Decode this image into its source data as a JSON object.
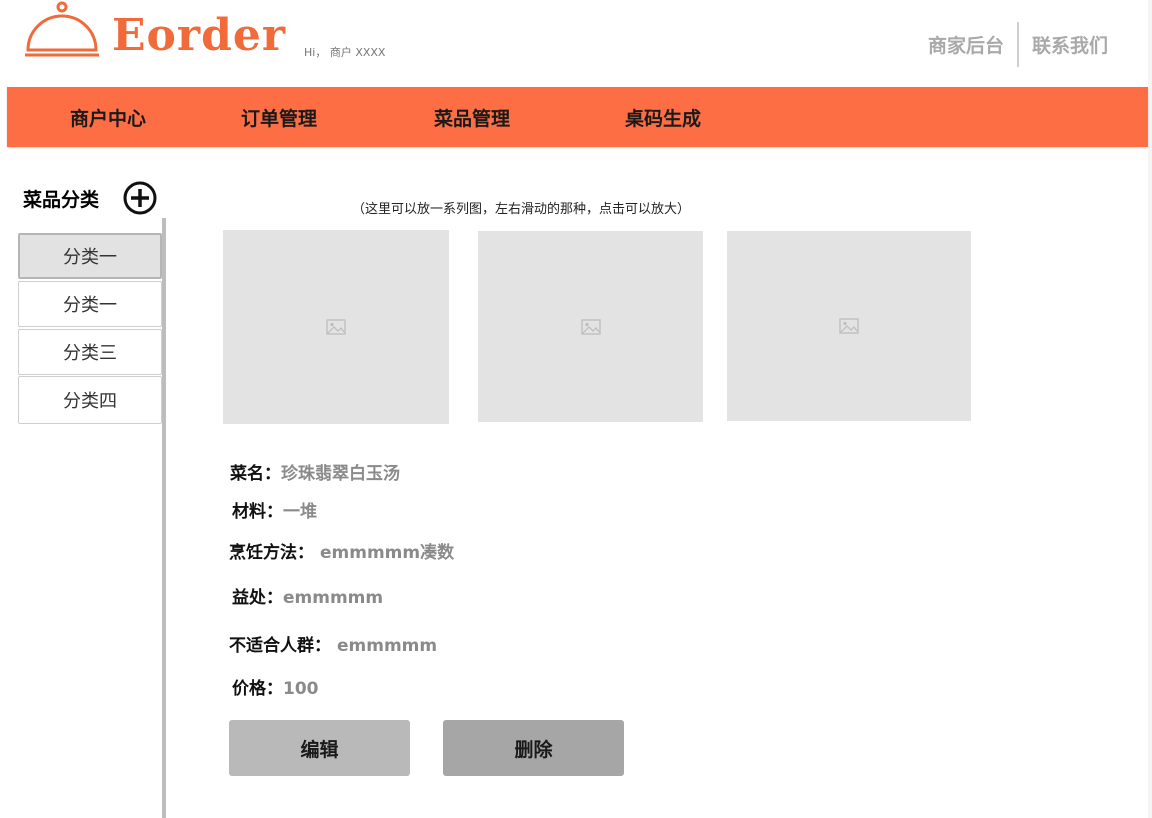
{
  "header": {
    "logo_text": "Eorder",
    "greeting": "Hi， 商户 XXXX",
    "links": [
      "商家后台",
      "联系我们"
    ]
  },
  "nav": {
    "items": [
      "商户中心",
      "订单管理",
      "菜品管理",
      "桌码生成"
    ]
  },
  "sidebar": {
    "title": "菜品分类",
    "categories": [
      "分类一",
      "分类一",
      "分类三",
      "分类四"
    ],
    "active_index": 0
  },
  "gallery": {
    "hint": "（这里可以放一系列图，左右滑动的那种，点击可以放大）",
    "image_count": 3
  },
  "dish": {
    "name_label": "菜名：",
    "name_value": "珍珠翡翠白玉汤",
    "material_label": "材料：",
    "material_value": "一堆",
    "method_label": "烹饪方法：",
    "method_value": "emmmmm凑数",
    "benefit_label": "益处：",
    "benefit_value": "emmmmm",
    "unsuitable_label": "不适合人群：",
    "unsuitable_value": "emmmmm",
    "price_label": "价格：",
    "price_value": "100"
  },
  "actions": {
    "edit_label": "编辑",
    "delete_label": "删除"
  },
  "colors": {
    "brand": "#f06a3a",
    "nav_bg": "#fe6e45",
    "edit_bg": "#b9b9b9",
    "delete_bg": "#a6a6a6"
  },
  "icons": {
    "logo": "cloche-icon",
    "add": "plus-circle-icon",
    "image_placeholder": "image-placeholder-icon"
  }
}
